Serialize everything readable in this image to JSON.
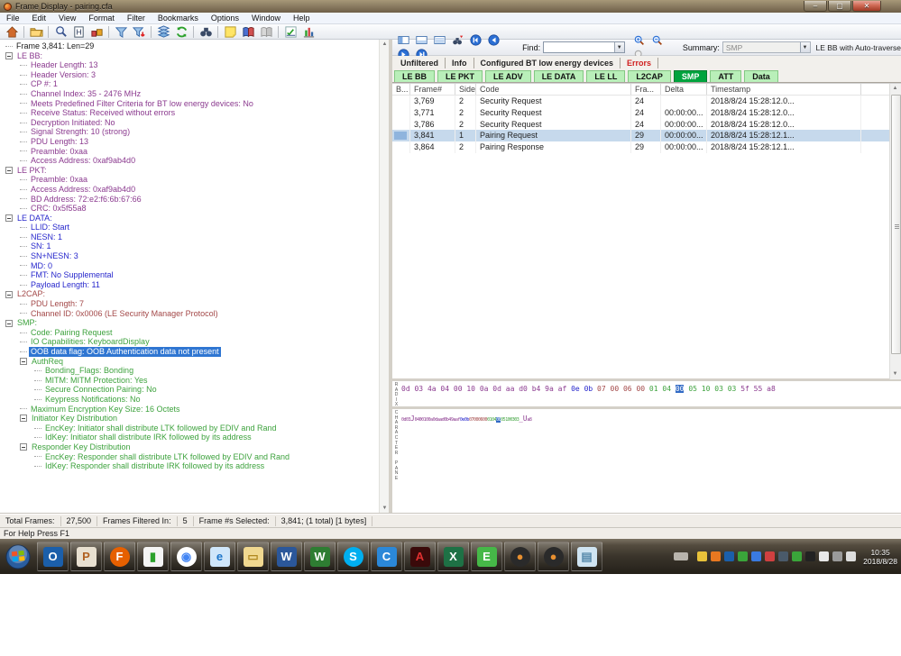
{
  "window": {
    "title": "Frame Display - pairing.cfa",
    "minimize": "–",
    "maximize": "▢",
    "close": "✕"
  },
  "menu": [
    "File",
    "Edit",
    "View",
    "Format",
    "Filter",
    "Bookmarks",
    "Options",
    "Window",
    "Help"
  ],
  "main_toolbar_icons": [
    "home",
    "open-file",
    "zoom",
    "find-frame",
    "io-parameters",
    "filter",
    "filter-apply",
    "duplicate-display",
    "refresh",
    "find-binoculars",
    "add-note",
    "decoder-book",
    "decoder-book-disabled",
    "signal-display",
    "statistics-chart"
  ],
  "tree_colors": {
    "black": "#1a1a1a",
    "purple": "#8b3a8f",
    "blue": "#2727cc",
    "red": "#a34848",
    "green": "#3da23d"
  },
  "tree": [
    {
      "t": "Frame 3,841:  Len=29",
      "c": "k",
      "l": 0
    },
    {
      "t": "LE BB:",
      "c": "p",
      "l": 0,
      "e": 1
    },
    {
      "t": "Header Length: 13",
      "c": "p",
      "l": 1
    },
    {
      "t": "Header Version: 3",
      "c": "p",
      "l": 1
    },
    {
      "t": "CP #: 1",
      "c": "p",
      "l": 1
    },
    {
      "t": "Channel Index: 35 - 2476 MHz",
      "c": "p",
      "l": 1
    },
    {
      "t": "Meets Predefined Filter Criteria for BT low energy devices: No",
      "c": "p",
      "l": 1
    },
    {
      "t": "Receive Status: Received without errors",
      "c": "p",
      "l": 1
    },
    {
      "t": "Decryption Initiated: No",
      "c": "p",
      "l": 1
    },
    {
      "t": "Signal Strength: 10 (strong)",
      "c": "p",
      "l": 1
    },
    {
      "t": "PDU Length: 13",
      "c": "p",
      "l": 1
    },
    {
      "t": "Preamble: 0xaa",
      "c": "p",
      "l": 1
    },
    {
      "t": "Access Address: 0xaf9ab4d0",
      "c": "p",
      "l": 1
    },
    {
      "t": "LE PKT:",
      "c": "p",
      "l": 0,
      "e": 1
    },
    {
      "t": "Preamble: 0xaa",
      "c": "p",
      "l": 1
    },
    {
      "t": "Access Address: 0xaf9ab4d0",
      "c": "p",
      "l": 1
    },
    {
      "t": "BD Address: 72:e2:f6:6b:67:66",
      "c": "p",
      "l": 1
    },
    {
      "t": "CRC: 0x5f55a8",
      "c": "p",
      "l": 1
    },
    {
      "t": "LE DATA:",
      "c": "b",
      "l": 0,
      "e": 1
    },
    {
      "t": "LLID: Start",
      "c": "b",
      "l": 1
    },
    {
      "t": "NESN: 1",
      "c": "b",
      "l": 1
    },
    {
      "t": "SN: 1",
      "c": "b",
      "l": 1
    },
    {
      "t": "SN+NESN: 3",
      "c": "b",
      "l": 1
    },
    {
      "t": "MD: 0",
      "c": "b",
      "l": 1
    },
    {
      "t": "FMT: No Supplemental",
      "c": "b",
      "l": 1
    },
    {
      "t": "Payload Length: 11",
      "c": "b",
      "l": 1
    },
    {
      "t": "L2CAP:",
      "c": "r",
      "l": 0,
      "e": 1
    },
    {
      "t": "PDU Length: 7",
      "c": "r",
      "l": 1
    },
    {
      "t": "Channel ID: 0x0006  (LE Security Manager Protocol)",
      "c": "r",
      "l": 1
    },
    {
      "t": "SMP:",
      "c": "g",
      "l": 0,
      "e": 1
    },
    {
      "t": "Code: Pairing Request",
      "c": "g",
      "l": 1
    },
    {
      "t": "IO Capabilities: KeyboardDisplay",
      "c": "g",
      "l": 1
    },
    {
      "t": "OOB data flag: OOB Authentication data not present",
      "c": "g",
      "l": 1,
      "s": 1
    },
    {
      "t": "AuthReq",
      "c": "g",
      "l": 1,
      "e": 1
    },
    {
      "t": "Bonding_Flags: Bonding",
      "c": "g",
      "l": 2
    },
    {
      "t": "MITM: MITM Protection:  Yes",
      "c": "g",
      "l": 2
    },
    {
      "t": "Secure Connection Pairing: No",
      "c": "g",
      "l": 2
    },
    {
      "t": "Keypress Notifications: No",
      "c": "g",
      "l": 2
    },
    {
      "t": "Maximum Encryption Key Size: 16 Octets",
      "c": "g",
      "l": 1
    },
    {
      "t": "Initiator Key Distribution",
      "c": "g",
      "l": 1,
      "e": 1
    },
    {
      "t": "EncKey: Initiator shall distribute LTK followed by EDIV and Rand",
      "c": "g",
      "l": 2
    },
    {
      "t": "IdKey: Initiator shall distribute IRK followed by its address",
      "c": "g",
      "l": 2
    },
    {
      "t": "Responder Key Distribution",
      "c": "g",
      "l": 1,
      "e": 1
    },
    {
      "t": "EncKey: Responder shall distribute LTK followed by EDIV and Rand",
      "c": "g",
      "l": 2
    },
    {
      "t": "IdKey: Responder shall distribute IRK followed by its address",
      "c": "g",
      "l": 2
    }
  ],
  "right_toolbar": {
    "icons_left": [
      "pane-vertical",
      "pane-horizontal",
      "pane-list",
      "find-frame-binoculars",
      "nav-first",
      "nav-prev",
      "nav-next",
      "nav-last"
    ],
    "find_label": "Find:",
    "find_value": "",
    "icons_zoom": [
      "zoom-in",
      "zoom-out",
      "zoom-disabled"
    ],
    "summary_label": "Summary:",
    "summary_value": "SMP",
    "traverse_text": "LE BB with Auto-traverse"
  },
  "filter_tabs": [
    {
      "label": "Unfiltered",
      "error": false
    },
    {
      "label": "Info",
      "error": false
    },
    {
      "label": "Configured BT low energy devices",
      "error": false
    },
    {
      "label": "Errors",
      "error": true
    }
  ],
  "protocol_tabs": [
    {
      "label": "LE BB",
      "sel": false
    },
    {
      "label": "LE PKT",
      "sel": false
    },
    {
      "label": "LE ADV",
      "sel": false
    },
    {
      "label": "LE DATA",
      "sel": false
    },
    {
      "label": "LE LL",
      "sel": false
    },
    {
      "label": "L2CAP",
      "sel": false
    },
    {
      "label": "SMP",
      "sel": true
    },
    {
      "label": "ATT",
      "sel": false
    },
    {
      "label": "Data",
      "sel": false
    }
  ],
  "table": {
    "headers": [
      "B...",
      "Frame#",
      "Side",
      "Code",
      "Fra...",
      "Delta",
      "Timestamp"
    ],
    "rows": [
      {
        "frame": "3,769",
        "side": "2",
        "code": "Security Request",
        "fra": "24",
        "delta": "",
        "ts": "2018/8/24 15:28:12.0...",
        "sel": false
      },
      {
        "frame": "3,771",
        "side": "2",
        "code": "Security Request",
        "fra": "24",
        "delta": "00:00:00...",
        "ts": "2018/8/24 15:28:12.0...",
        "sel": false
      },
      {
        "frame": "3,786",
        "side": "2",
        "code": "Security Request",
        "fra": "24",
        "delta": "00:00:00...",
        "ts": "2018/8/24 15:28:12.0...",
        "sel": false
      },
      {
        "frame": "3,841",
        "side": "1",
        "code": "Pairing Request",
        "fra": "29",
        "delta": "00:00:00...",
        "ts": "2018/8/24 15:28:12.1...",
        "sel": true
      },
      {
        "frame": "3,864",
        "side": "2",
        "code": "Pairing Response",
        "fra": "29",
        "delta": "00:00:00...",
        "ts": "2018/8/24 15:28:12.1...",
        "sel": false
      }
    ]
  },
  "hex_pane": {
    "label": "RADIX",
    "groups": [
      {
        "bytes": [
          "0d",
          "03",
          "4a",
          "04",
          "00",
          "10",
          "0a",
          "0d",
          "aa",
          "d0",
          "b4",
          "9a",
          "af"
        ],
        "c": "p",
        "sel": false
      },
      {
        "bytes": [
          "0e",
          "0b"
        ],
        "c": "b",
        "sel": false
      },
      {
        "bytes": [
          "07",
          "00",
          "06",
          "00"
        ],
        "c": "r",
        "sel": false
      },
      {
        "bytes": [
          "01",
          "04"
        ],
        "c": "g",
        "sel": false
      },
      {
        "bytes": [
          "00"
        ],
        "c": "g",
        "sel": true
      },
      {
        "bytes": [
          "05",
          "10",
          "03",
          "03"
        ],
        "c": "g",
        "sel": false
      },
      {
        "bytes": [
          "5f",
          "55",
          "a8"
        ],
        "c": "p",
        "sel": false
      }
    ]
  },
  "char_pane": {
    "label": "CHARACTER PANE"
  },
  "status": {
    "segments": [
      {
        "label": "Total Frames:",
        "value": "27,500"
      },
      {
        "label": "Frames Filtered In:",
        "value": "5"
      },
      {
        "label": "Frame #s Selected:",
        "value": "3,841; (1 total) [1 bytes]"
      }
    ],
    "help": "For Help Press F1"
  },
  "taskbar": {
    "apps": [
      "outlook",
      "paint",
      "firefox",
      "capture-chart",
      "chrome",
      "internet-explorer",
      "file-explorer",
      "word",
      "wps",
      "skype",
      "communicator",
      "acrobat",
      "excel",
      "evernote",
      "comprobe-1",
      "comprobe-2",
      "notepad"
    ],
    "tray": [
      "keyboard",
      "shield",
      "orange-app",
      "outlook-tray",
      "green-globe",
      "blue-globe",
      "red-pie",
      "monitor",
      "green-box",
      "dish",
      "clipboard",
      "network",
      "speaker"
    ],
    "clock_time": "10:35",
    "clock_date": "2018/8/28"
  }
}
